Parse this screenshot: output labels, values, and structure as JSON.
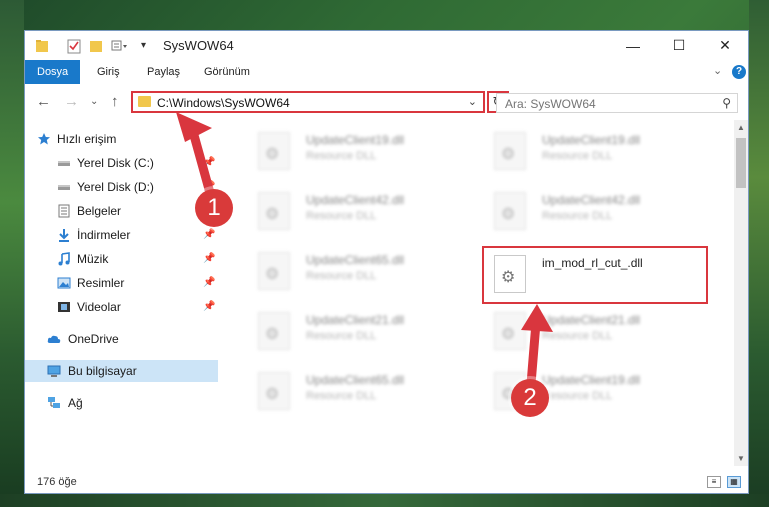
{
  "window": {
    "title": "SysWOW64"
  },
  "ribbon": {
    "tabs": [
      {
        "label": "Dosya",
        "active": true
      },
      {
        "label": "Giriş",
        "active": false
      },
      {
        "label": "Paylaş",
        "active": false
      },
      {
        "label": "Görünüm",
        "active": false
      }
    ],
    "help_label": "?"
  },
  "navigation": {
    "address": "C:\\Windows\\SysWOW64",
    "search_placeholder": "Ara: SysWOW64"
  },
  "sidebar": {
    "items": [
      {
        "label": "Hızlı erişim",
        "icon": "star-icon"
      },
      {
        "label": "Yerel Disk (C:)",
        "icon": "drive-icon"
      },
      {
        "label": "Yerel Disk (D:)",
        "icon": "drive-icon"
      },
      {
        "label": "Belgeler",
        "icon": "documents-icon"
      },
      {
        "label": "İndirmeler",
        "icon": "download-icon"
      },
      {
        "label": "Müzik",
        "icon": "music-icon"
      },
      {
        "label": "Resimler",
        "icon": "pictures-icon"
      },
      {
        "label": "Videolar",
        "icon": "videos-icon"
      },
      {
        "label": "OneDrive",
        "icon": "cloud-icon"
      },
      {
        "label": "Bu bilgisayar",
        "icon": "computer-icon",
        "selected": true
      },
      {
        "label": "Ağ",
        "icon": "network-icon"
      }
    ]
  },
  "files": [
    {
      "name": "UpdateClient19.dll",
      "type": "Resource DLL"
    },
    {
      "name": "UpdateClient19.dll",
      "type": "Resource DLL"
    },
    {
      "name": "UpdateClient42.dll",
      "type": "Resource DLL"
    },
    {
      "name": "UpdateClient42.dll",
      "type": "Resource DLL"
    },
    {
      "name": "UpdateClient65.dll",
      "type": "Resource DLL"
    },
    {
      "name": "im_mod_rl_cut_.dll",
      "type": ""
    },
    {
      "name": "UpdateClient21.dll",
      "type": "Resource DLL"
    },
    {
      "name": "UpdateClient21.dll",
      "type": "Resource DLL"
    },
    {
      "name": "UpdateClient65.dll",
      "type": "Resource DLL"
    },
    {
      "name": "UpdateClient19.dll",
      "type": "Resource DLL"
    }
  ],
  "status": {
    "item_count": "176 öğe"
  },
  "annotations": {
    "step1": "1",
    "step2": "2",
    "color": "#d9363e"
  }
}
